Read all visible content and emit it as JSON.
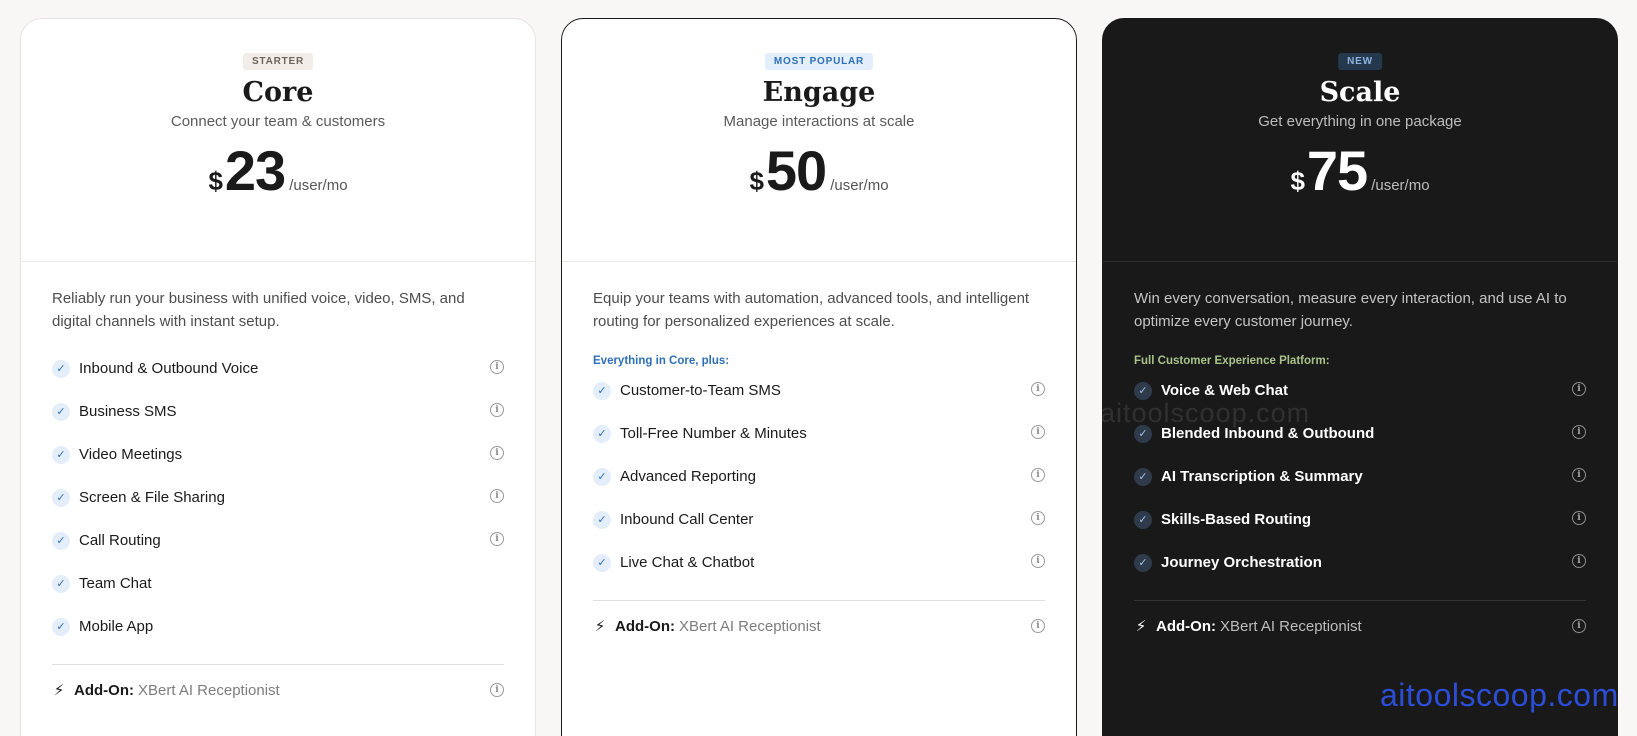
{
  "plans": [
    {
      "badge": "STARTER",
      "name": "Core",
      "tagline": "Connect your team & customers",
      "currency": "$",
      "amount": "23",
      "unit": "/user/mo",
      "description": "Reliably run your business with unified voice, video, SMS, and digital channels with instant setup.",
      "section_label": "",
      "features": [
        {
          "label": "Inbound & Outbound Voice",
          "info": true
        },
        {
          "label": "Business SMS",
          "info": true
        },
        {
          "label": "Video Meetings",
          "info": true
        },
        {
          "label": "Screen & File Sharing",
          "info": true
        },
        {
          "label": "Call Routing",
          "info": true
        },
        {
          "label": "Team Chat",
          "info": false
        },
        {
          "label": "Mobile App",
          "info": false
        }
      ],
      "addon_label": "Add-On:",
      "addon_value": "XBert AI Receptionist"
    },
    {
      "badge": "MOST POPULAR",
      "name": "Engage",
      "tagline": "Manage interactions at scale",
      "currency": "$",
      "amount": "50",
      "unit": "/user/mo",
      "description": "Equip your teams with automation, advanced tools, and intelligent routing for personalized experiences at scale.",
      "section_label": "Everything in Core, plus:",
      "features": [
        {
          "label": "Customer-to-Team SMS",
          "info": true
        },
        {
          "label": "Toll-Free Number & Minutes",
          "info": true
        },
        {
          "label": "Advanced Reporting",
          "info": true
        },
        {
          "label": "Inbound Call Center",
          "info": true
        },
        {
          "label": "Live Chat & Chatbot",
          "info": true
        }
      ],
      "addon_label": "Add-On:",
      "addon_value": "XBert AI Receptionist"
    },
    {
      "badge": "NEW",
      "name": "Scale",
      "tagline": "Get everything in one package",
      "currency": "$",
      "amount": "75",
      "unit": "/user/mo",
      "description": "Win every conversation, measure every interaction, and use AI to optimize every customer journey.",
      "section_label": "Full Customer Experience Platform:",
      "features": [
        {
          "label": "Voice & Web Chat",
          "info": true
        },
        {
          "label": "Blended Inbound & Outbound",
          "info": true
        },
        {
          "label": "AI Transcription & Summary",
          "info": true
        },
        {
          "label": "Skills-Based Routing",
          "info": true
        },
        {
          "label": "Journey Orchestration",
          "info": true
        }
      ],
      "addon_label": "Add-On:",
      "addon_value": "XBert AI Receptionist"
    }
  ],
  "icons": {
    "check": "check-icon",
    "info": "info-icon",
    "addon": "sparkle-icon"
  },
  "colors": {
    "accent_blue": "#2d6fb8",
    "dark_card": "#191919",
    "page_bg": "#f8f7f5"
  },
  "watermarks": [
    "aitoolscoop.com",
    "aitoolscoop.com"
  ]
}
